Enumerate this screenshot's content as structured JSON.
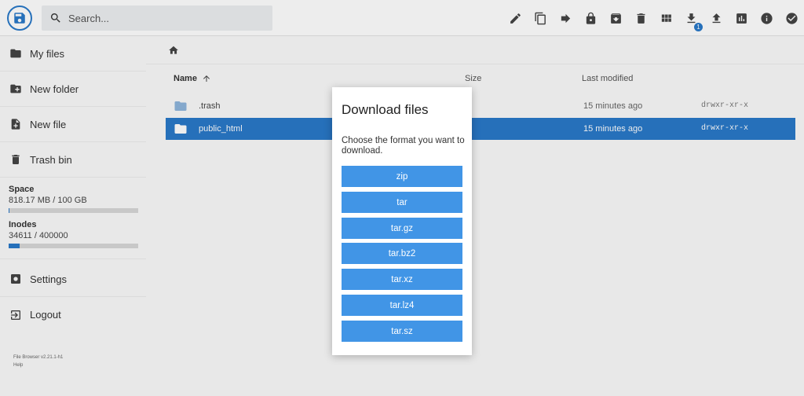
{
  "header": {
    "search_placeholder": "Search...",
    "badge_count": "1"
  },
  "sidebar": {
    "items": [
      {
        "label": "My files"
      },
      {
        "label": "New folder"
      },
      {
        "label": "New file"
      },
      {
        "label": "Trash bin"
      }
    ],
    "space": {
      "title": "Space",
      "value": "818.17 MB / 100 GB",
      "fraction": 0.008
    },
    "inodes": {
      "title": "Inodes",
      "value": "34611 / 400000",
      "fraction": 0.0865
    },
    "settings_label": "Settings",
    "logout_label": "Logout",
    "footer_version": "File Browser v2.21.1-h1",
    "footer_help": "Help"
  },
  "listing": {
    "columns": {
      "name": "Name",
      "size": "Size",
      "modified": "Last modified"
    },
    "rows": [
      {
        "name": ".trash",
        "modified": "15 minutes ago",
        "perm": "drwxr-xr-x",
        "selected": false
      },
      {
        "name": "public_html",
        "modified": "15 minutes ago",
        "perm": "drwxr-xr-x",
        "selected": true
      }
    ]
  },
  "modal": {
    "title": "Download files",
    "text": "Choose the format you want to download.",
    "formats": [
      "zip",
      "tar",
      "tar.gz",
      "tar.bz2",
      "tar.xz",
      "tar.lz4",
      "tar.sz"
    ]
  },
  "colors": {
    "accent": "#2979c9",
    "button": "#4195e6"
  }
}
